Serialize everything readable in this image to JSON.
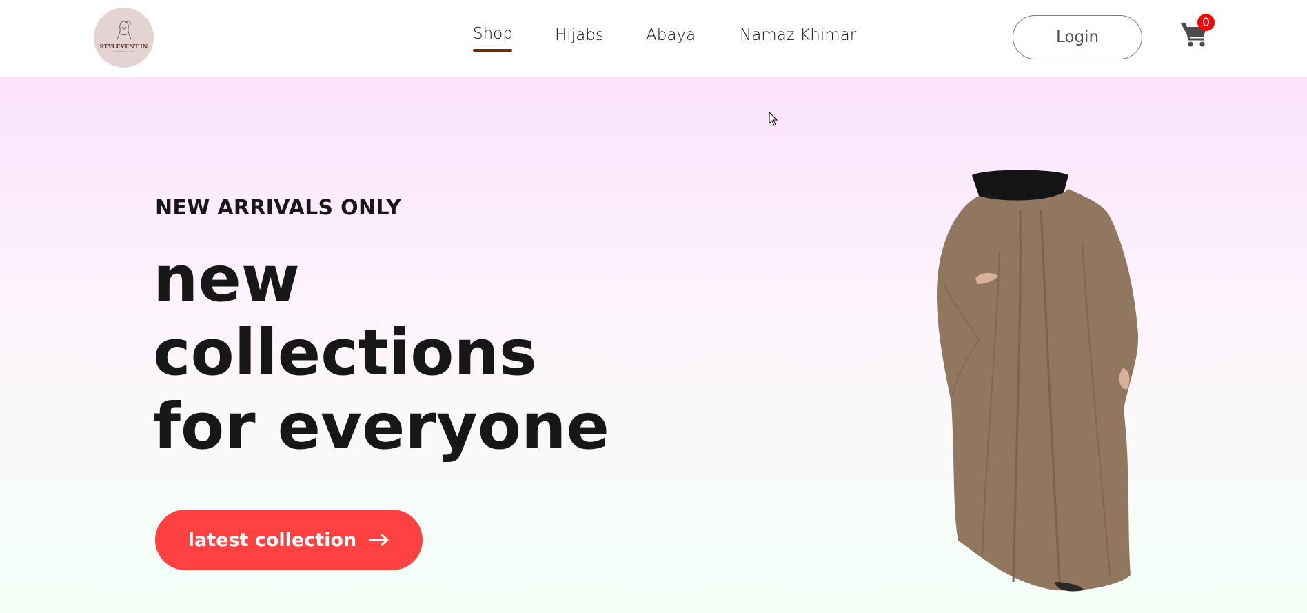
{
  "brand": {
    "logo_text": "STYLEVENT.IN",
    "logo_subtext": "modest fashion shop"
  },
  "nav": {
    "items": [
      {
        "label": "Shop",
        "active": true
      },
      {
        "label": "Hijabs",
        "active": false
      },
      {
        "label": "Abaya",
        "active": false
      },
      {
        "label": "Namaz Khimar",
        "active": false
      }
    ]
  },
  "header": {
    "login_label": "Login",
    "cart_count": "0"
  },
  "hero": {
    "eyebrow": "NEW ARRIVALS ONLY",
    "title_lines": [
      "new",
      "collections",
      "for everyone"
    ],
    "cta_label": "latest collection"
  },
  "colors": {
    "accent": "#ff4141",
    "nav_underline": "#6b2f0e",
    "hero_top": "#fbe2fd",
    "hero_bottom": "#f3fff7",
    "cart_badge": "#ff0000"
  },
  "icons": {
    "cart": "shopping-cart-icon",
    "arrow": "arrow-right-icon"
  }
}
